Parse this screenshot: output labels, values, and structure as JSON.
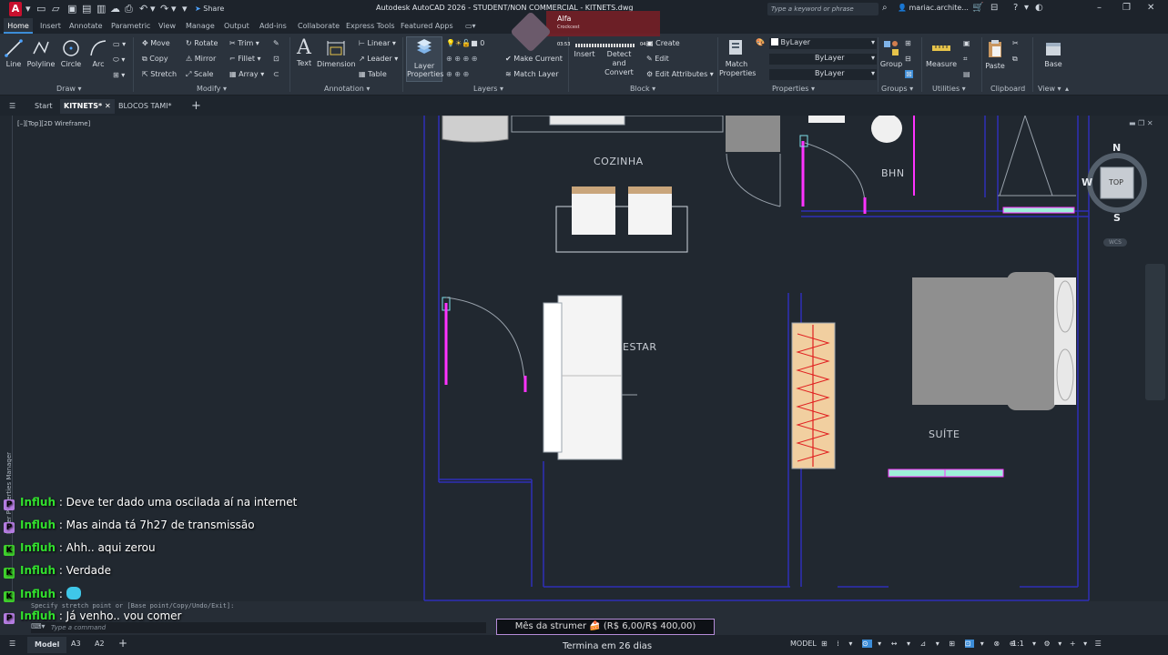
{
  "titlebar": {
    "logo": "A",
    "share": "Share",
    "title": "Autodesk AutoCAD 2026 - STUDENT/NON COMMERCIAL - KITNETS.dwg",
    "search_placeholder": "Type a keyword or phrase",
    "user": "mariac.archite..."
  },
  "menu": {
    "tabs": [
      "Home",
      "Insert",
      "Annotate",
      "Parametric",
      "View",
      "Manage",
      "Output",
      "Add-ins",
      "Collaborate",
      "Express Tools",
      "Featured Apps"
    ]
  },
  "ribbon": {
    "draw": {
      "line": "Line",
      "polyline": "Polyline",
      "circle": "Circle",
      "arc": "Arc",
      "panel": "Draw"
    },
    "modify": {
      "move": "Move",
      "rotate": "Rotate",
      "trim": "Trim",
      "copy": "Copy",
      "mirror": "Mirror",
      "fillet": "Fillet",
      "stretch": "Stretch",
      "scale": "Scale",
      "array": "Array",
      "panel": "Modify"
    },
    "annotation": {
      "text": "Text",
      "dimension": "Dimension",
      "linear": "Linear",
      "leader": "Leader",
      "table": "Table",
      "panel": "Annotation"
    },
    "layers": {
      "layer_properties": "Layer Properties",
      "layer_value": "0",
      "make_current": "Make Current",
      "match_layer": "Match Layer",
      "panel": "Layers"
    },
    "block": {
      "insert": "Insert",
      "create": "Create",
      "edit": "Edit",
      "detect": "Detect and Convert",
      "edit_attributes": "Edit Attributes",
      "panel": "Block"
    },
    "properties": {
      "match": "Match Properties",
      "bylayer1": "ByLayer",
      "bylayer2": "ByLayer",
      "bylayer3": "ByLayer",
      "panel": "Properties"
    },
    "groups": {
      "group": "Group",
      "panel": "Groups"
    },
    "utilities": {
      "measure": "Measure",
      "panel": "Utilities"
    },
    "clipboard": {
      "paste": "Paste",
      "panel": "Clipboard"
    },
    "view": {
      "base": "Base",
      "panel": "View"
    }
  },
  "doc_tabs": {
    "start": "Start",
    "kitnets": "KITNETS*",
    "blocos": "BLOCOS TAMI*"
  },
  "viewport": {
    "label": "[–][Top][2D Wireframe]",
    "side_panel": "Layer Properties Manager"
  },
  "rooms": {
    "cozinha": "COZINHA",
    "bhn": "BHN",
    "estar": "ESTAR",
    "suite": "SUÍTE"
  },
  "viewcube": {
    "n": "N",
    "s": "S",
    "w": "W",
    "top": "TOP",
    "wcs": "WCS"
  },
  "music": {
    "song": "Alfa",
    "artist": "Crockcest",
    "elapsed": "03:53",
    "total": "04:45"
  },
  "chat": [
    {
      "badge": "P",
      "badge_color": "#b47ce0",
      "user": "Influh",
      "msg": "Deve ter dado uma oscilada aí na internet"
    },
    {
      "badge": "P",
      "badge_color": "#b47ce0",
      "user": "Influh",
      "msg": "Mas ainda tá 7h27 de transmissão"
    },
    {
      "badge": "K",
      "badge_color": "#3fd12c",
      "user": "Influh",
      "msg": "Ahh.. aqui zerou"
    },
    {
      "badge": "K",
      "badge_color": "#3fd12c",
      "user": "Influh",
      "msg": "Verdade"
    },
    {
      "badge": "K",
      "badge_color": "#3fd12c",
      "user": "Influh",
      "msg": ""
    },
    {
      "badge": "P",
      "badge_color": "#b47ce0",
      "user": "Influh",
      "msg": "Já venho.. vou comer"
    }
  ],
  "command": {
    "history": "Specify stretch point or [Base point/Copy/Undo/Exit]:",
    "placeholder": "Type a command"
  },
  "goal": {
    "text": "Mês da strumer 🍰 (R$ 6,00/R$ 400,00)",
    "footer": "Termina em 26 dias"
  },
  "status": {
    "model_tab": "Model",
    "a3": "A3",
    "a2": "A2",
    "model_btn": "MODEL",
    "scale": "1:1"
  },
  "colors": {
    "wall": "#2f2fb8",
    "door": "#ff33ff",
    "accent": "#3c8dd8",
    "chat_user": "#32e02e"
  }
}
